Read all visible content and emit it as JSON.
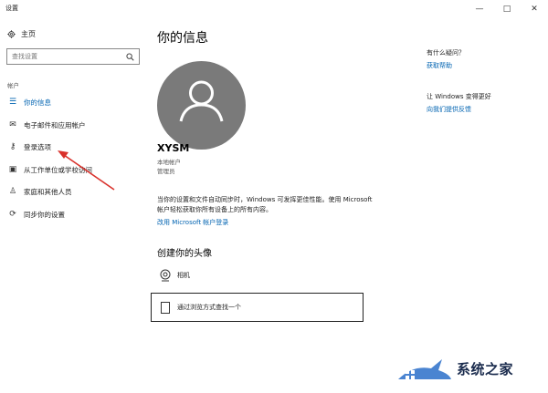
{
  "window": {
    "title": "设置",
    "min_glyph": "—",
    "max_glyph": "□",
    "close_glyph": "✕"
  },
  "sidebar": {
    "home_label": "主页",
    "search_placeholder": "查找设置",
    "section_label": "帐户",
    "items": [
      {
        "label": "你的信息",
        "icon": "person-list-icon",
        "active": true
      },
      {
        "label": "电子邮件和应用帐户",
        "icon": "mail-icon",
        "active": false
      },
      {
        "label": "登录选项",
        "icon": "key-icon",
        "active": false
      },
      {
        "label": "从工作单位或学校访问",
        "icon": "briefcase-icon",
        "active": false
      },
      {
        "label": "家庭和其他人员",
        "icon": "person-icon",
        "active": false
      },
      {
        "label": "同步你的设置",
        "icon": "sync-icon",
        "active": false
      }
    ]
  },
  "main": {
    "title": "你的信息",
    "username": "XYSM",
    "account_type": "本地帐户",
    "role": "管理员",
    "description": "当你的设置和文件自动同步时，Windows 可发挥更佳性能。使用 Microsoft 帐户轻松获取你所有设备上的所有内容。",
    "switch_link": "改用 Microsoft 帐户登录",
    "avatar_section_title": "创建你的头像",
    "camera_label": "相机",
    "browse_label": "通过浏览方式查找一个"
  },
  "right_panel": {
    "question": "有什么疑问？",
    "get_help": "获取帮助",
    "improve_title": "让 Windows 变得更好",
    "feedback": "向我们提供反馈"
  },
  "watermark": {
    "text": "系统之家"
  },
  "colors": {
    "accent": "#0063b1",
    "avatar_bg": "#7a7a7a",
    "annotation_arrow": "#d9312b"
  }
}
